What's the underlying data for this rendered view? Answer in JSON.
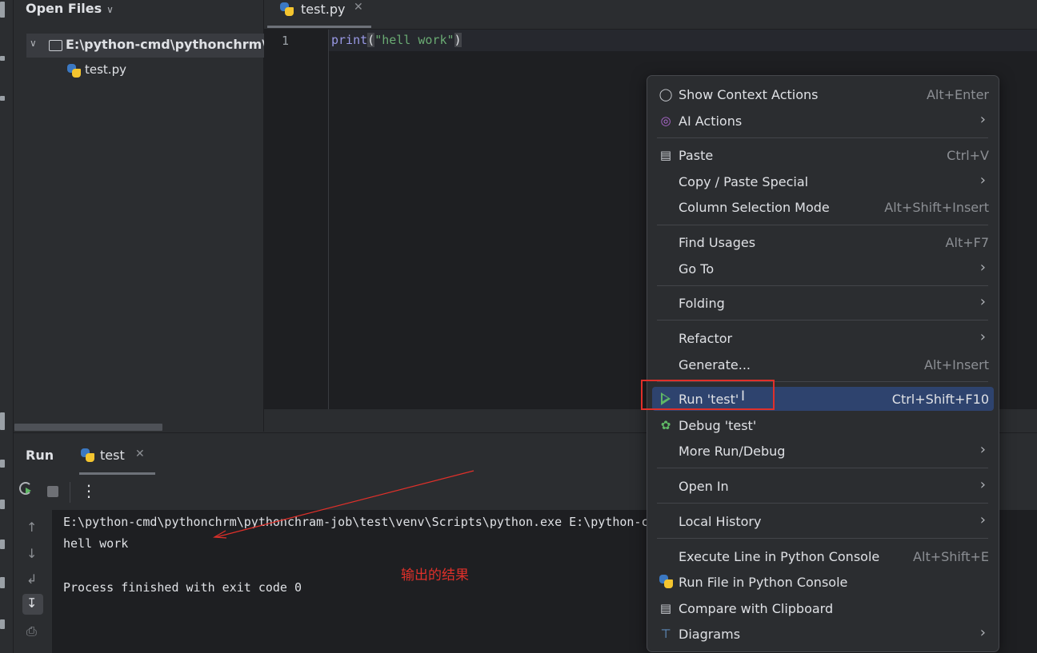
{
  "project_panel": {
    "title": "Open Files",
    "root_folder": "E:\\python-cmd\\pythonchrm\\p",
    "file": "test.py"
  },
  "editor": {
    "tab_label": "test.py",
    "line_number": "1",
    "code": {
      "keyword": "print",
      "open_paren": "(",
      "string": "\"hell work\"",
      "close_paren": ")"
    }
  },
  "run_window": {
    "title": "Run",
    "tab_label": "test",
    "console": [
      "E:\\python-cmd\\pythonchrm\\pythonchram-job\\test\\venv\\Scripts\\python.exe E:\\python-cmd\\pythonchrm\\pythonchram-job\\test\\test.p",
      "hell work",
      "",
      "Process finished with exit code 0"
    ]
  },
  "annotation": {
    "text": "输出的结果",
    "color": "#e0302a"
  },
  "context_menu": {
    "items": [
      {
        "label": "Show Context Actions",
        "shortcut": "Alt+Enter",
        "icon": "lightbulb-icon"
      },
      {
        "label": "AI Actions",
        "submenu": true,
        "icon": "ai-spiral-icon"
      },
      {
        "label": "Paste",
        "shortcut": "Ctrl+V",
        "icon": "clipboard-icon"
      },
      {
        "label": "Copy / Paste Special",
        "submenu": true
      },
      {
        "label": "Column Selection Mode",
        "shortcut": "Alt+Shift+Insert"
      },
      {
        "label": "Find Usages",
        "shortcut": "Alt+F7"
      },
      {
        "label": "Go To",
        "submenu": true
      },
      {
        "label": "Folding",
        "submenu": true
      },
      {
        "label": "Refactor",
        "submenu": true
      },
      {
        "label": "Generate...",
        "shortcut": "Alt+Insert"
      },
      {
        "label": "Run 'test'",
        "shortcut": "Ctrl+Shift+F10",
        "icon": "run-play-icon",
        "selected": true
      },
      {
        "label": "Debug 'test'",
        "icon": "debug-bug-icon"
      },
      {
        "label": "More Run/Debug",
        "submenu": true
      },
      {
        "label": "Open In",
        "submenu": true
      },
      {
        "label": "Local History",
        "submenu": true
      },
      {
        "label": "Execute Line in Python Console",
        "shortcut": "Alt+Shift+E"
      },
      {
        "label": "Run File in Python Console",
        "icon": "python-icon"
      },
      {
        "label": "Compare with Clipboard",
        "icon": "compare-clipboard-icon"
      },
      {
        "label": "Diagrams",
        "submenu": true,
        "icon": "diagram-icon"
      }
    ]
  },
  "colors": {
    "accent_selection": "#2e436e",
    "highlight_box": "#e0302a",
    "run_green": "#5fb865"
  }
}
